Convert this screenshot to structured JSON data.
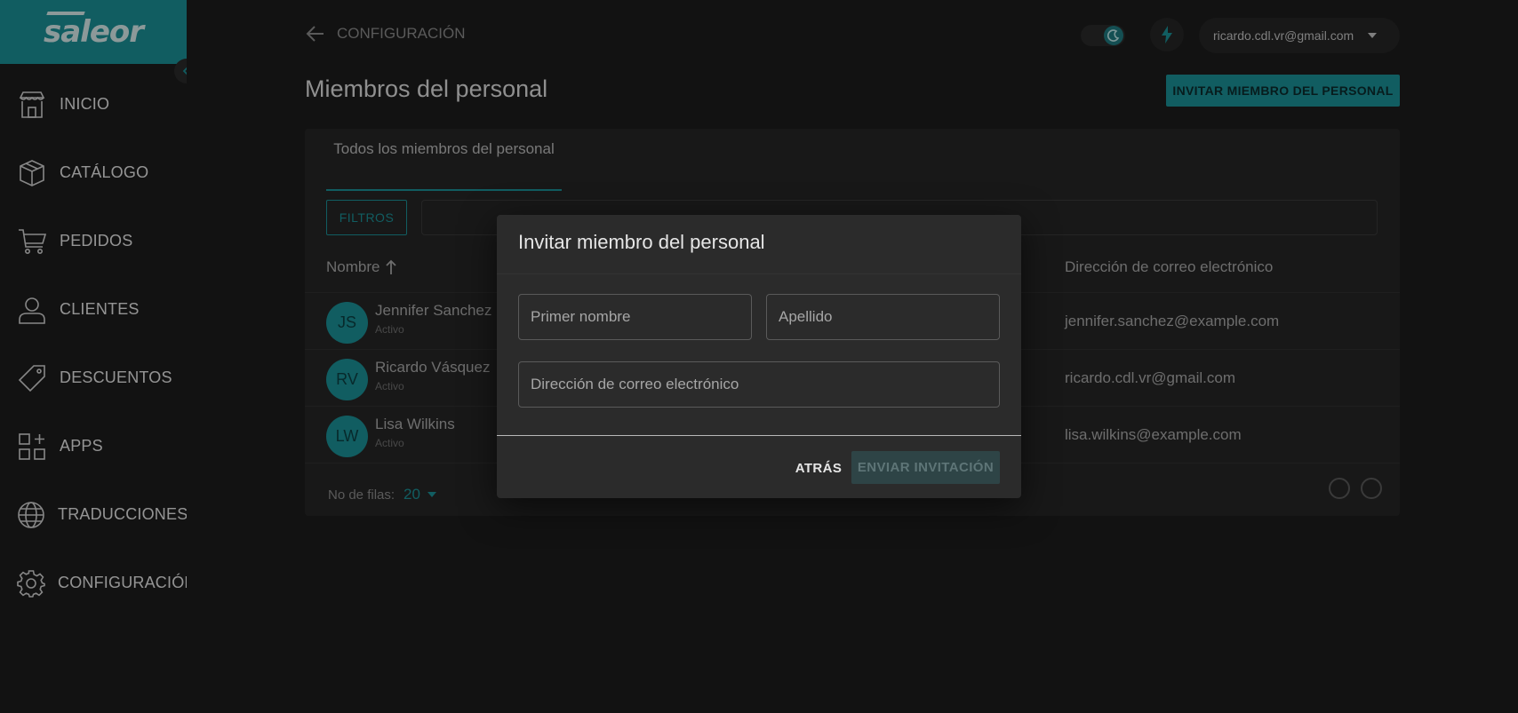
{
  "brand": {
    "logo_text": "saleor",
    "accent": "#1b8f95"
  },
  "sidebar": {
    "items": [
      {
        "label": "INICIO",
        "icon": "store-icon"
      },
      {
        "label": "CATÁLOGO",
        "icon": "box-icon"
      },
      {
        "label": "PEDIDOS",
        "icon": "cart-icon"
      },
      {
        "label": "CLIENTES",
        "icon": "user-icon"
      },
      {
        "label": "DESCUENTOS",
        "icon": "tag-icon"
      },
      {
        "label": "APPS",
        "icon": "apps-icon"
      },
      {
        "label": "TRADUCCIONES",
        "icon": "globe-icon"
      },
      {
        "label": "CONFIGURACIÓN",
        "icon": "gear-icon"
      }
    ]
  },
  "header": {
    "back_label": "CONFIGURACIÓN",
    "user_email": "ricardo.cdl.vr@gmail.com"
  },
  "page": {
    "title": "Miembros del personal",
    "invite_button": "INVITAR MIEMBRO DEL PERSONAL"
  },
  "list": {
    "tab_label": "Todos los miembros del personal",
    "filters_label": "FILTROS",
    "search_placeholder": "",
    "col_name": "Nombre",
    "col_email": "Dirección de correo electrónico",
    "rows": [
      {
        "initials": "JS",
        "name": "Jennifer Sanchez",
        "status": "Activo",
        "email": "jennifer.sanchez@example.com"
      },
      {
        "initials": "RV",
        "name": "Ricardo Vásquez",
        "status": "Activo",
        "email": "ricardo.cdl.vr@gmail.com"
      },
      {
        "initials": "LW",
        "name": "Lisa Wilkins",
        "status": "Activo",
        "email": "lisa.wilkins@example.com"
      }
    ],
    "rows_label": "No de filas:",
    "rows_value": "20"
  },
  "dialog": {
    "title": "Invitar miembro del personal",
    "first_name_placeholder": "Primer nombre",
    "last_name_placeholder": "Apellido",
    "email_placeholder": "Dirección de correo electrónico",
    "back_button": "ATRÁS",
    "send_button": "ENVIAR INVITACIÓN"
  }
}
